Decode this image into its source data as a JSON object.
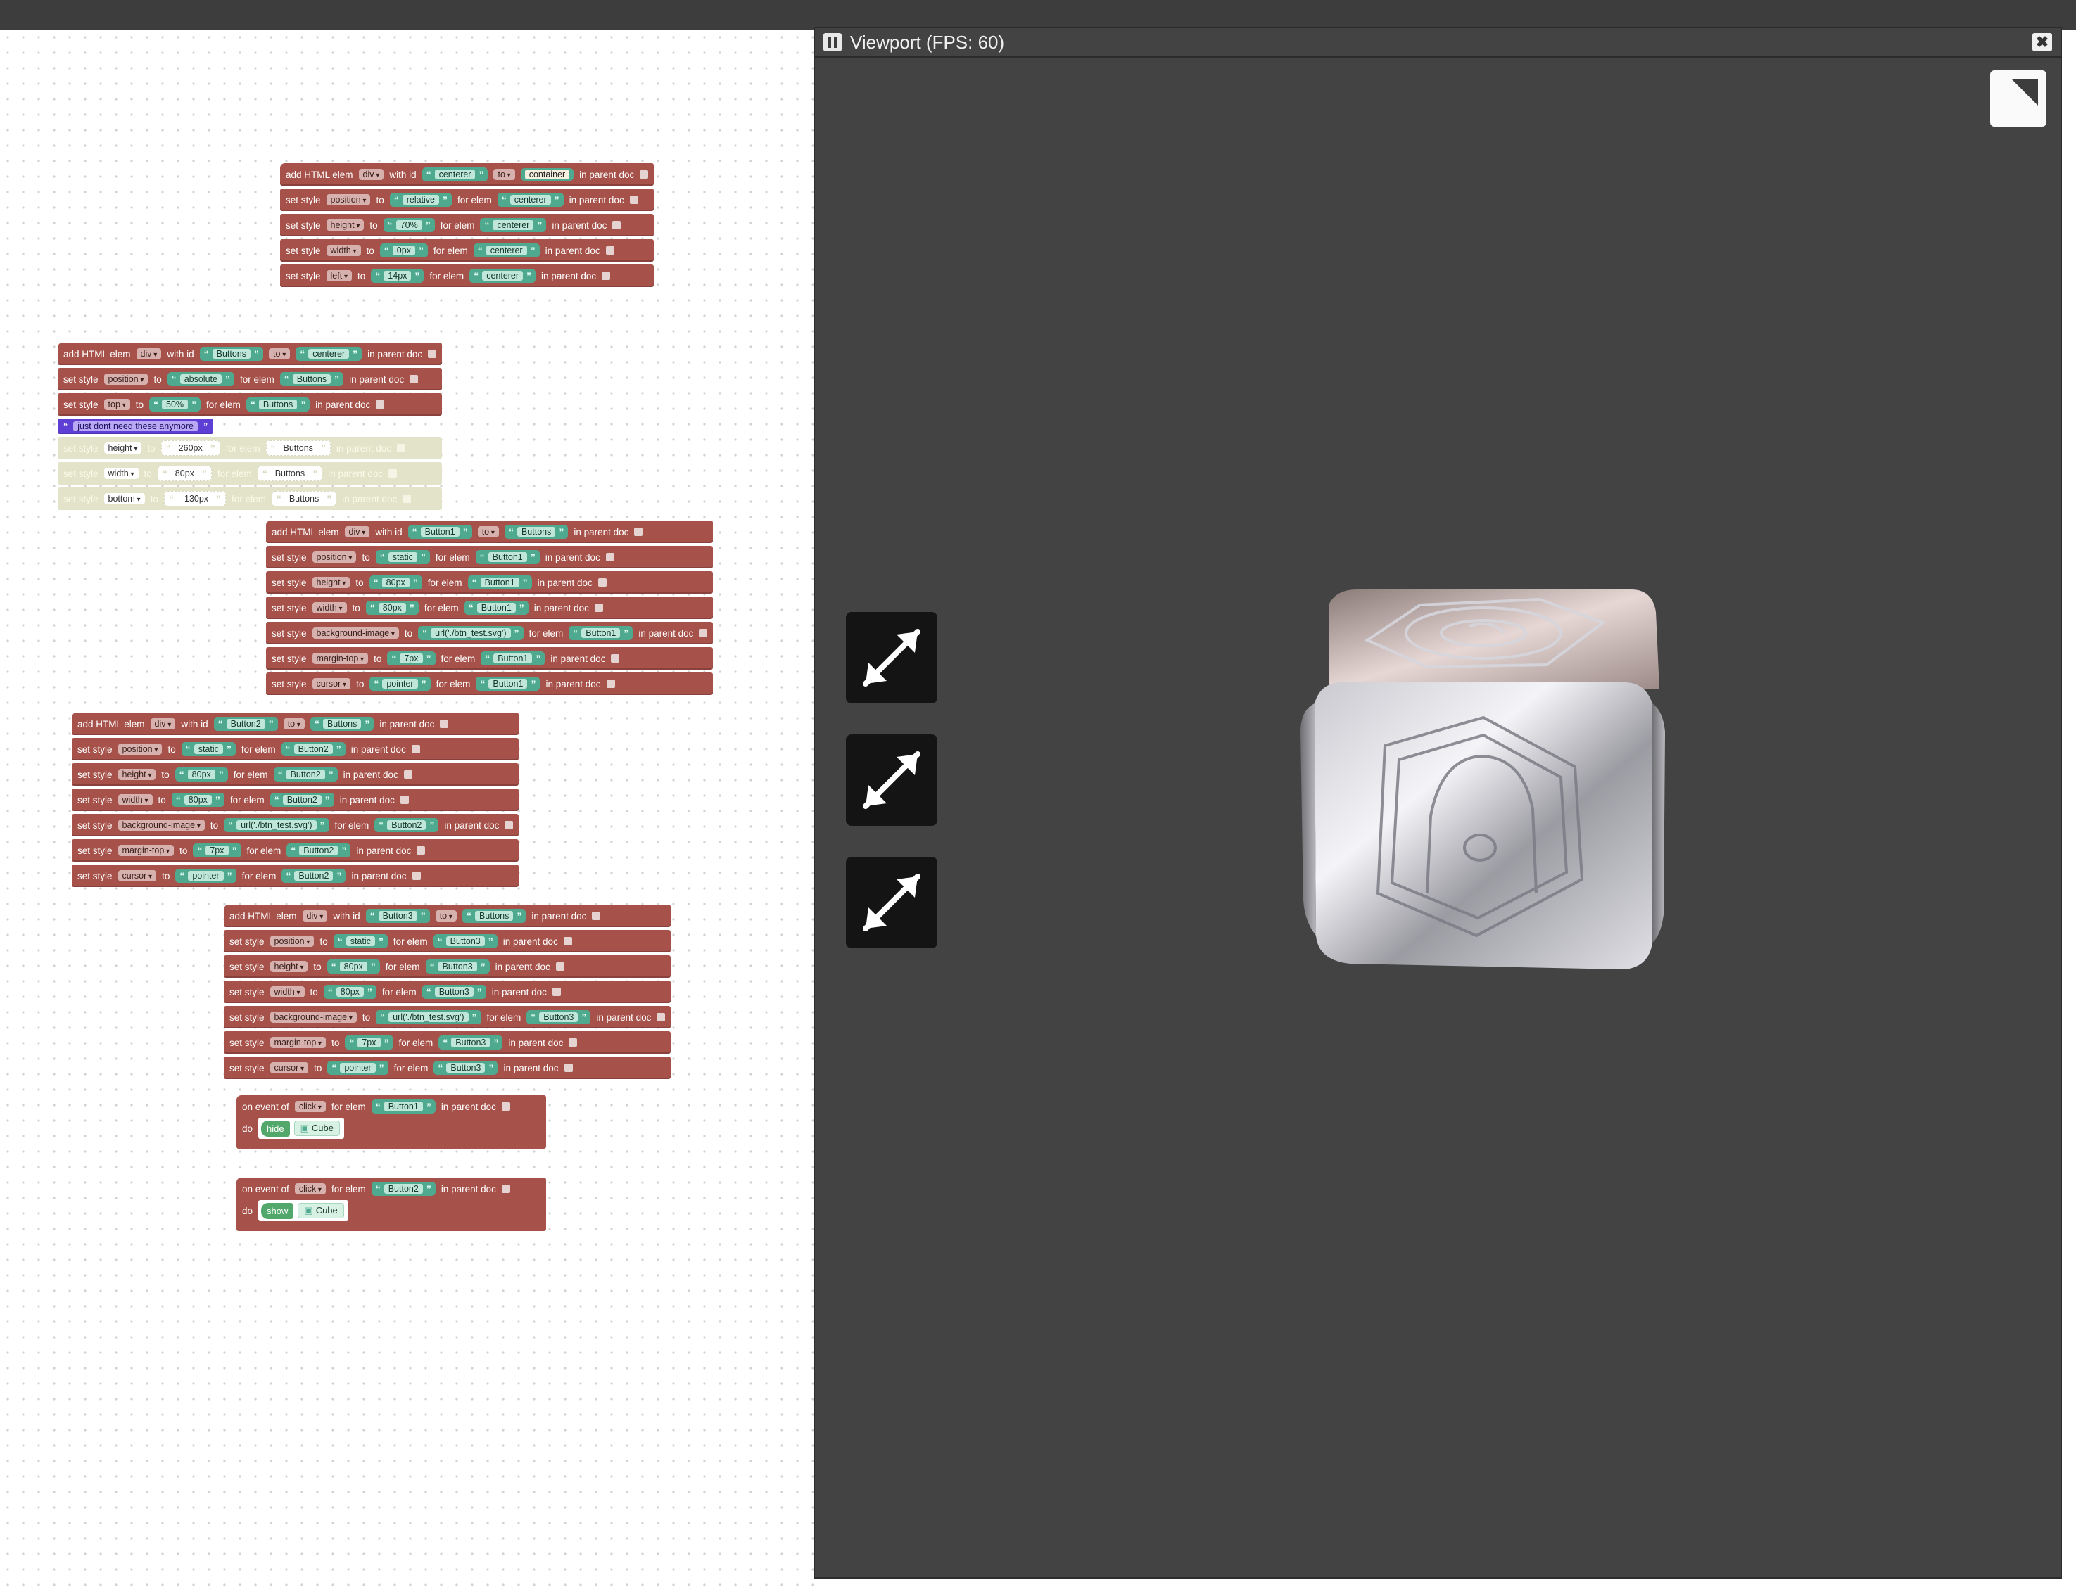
{
  "viewport": {
    "title": "Viewport (FPS: 60)",
    "close_label": "✖"
  },
  "labels": {
    "add": "add HTML elem",
    "with_id": "with id",
    "to": "to",
    "in_parent": "in parent doc",
    "set_style": "set style",
    "for_elem": "for elem",
    "on_event": "on event of",
    "do": "do",
    "q_open": "“",
    "q_close": "”"
  },
  "comment_text": "just dont need these anymore",
  "stack1": {
    "tag": "div",
    "id": "centerer",
    "to": "to",
    "parent": "container",
    "styles": [
      {
        "prop": "position",
        "value": "relative",
        "elem": "centerer"
      },
      {
        "prop": "height",
        "value": "70%",
        "elem": "centerer"
      },
      {
        "prop": "width",
        "value": "0px",
        "elem": "centerer"
      },
      {
        "prop": "left",
        "value": "14px",
        "elem": "centerer"
      }
    ]
  },
  "stack2": {
    "tag": "div",
    "id": "Buttons",
    "to": "to",
    "parent": "centerer",
    "styles": [
      {
        "prop": "position",
        "value": "absolute",
        "elem": "Buttons"
      },
      {
        "prop": "top",
        "value": "50%",
        "elem": "Buttons"
      }
    ],
    "disabled": [
      {
        "prop": "height",
        "value": "260px",
        "elem": "Buttons"
      },
      {
        "prop": "width",
        "value": "80px",
        "elem": "Buttons"
      },
      {
        "prop": "bottom",
        "value": "-130px",
        "elem": "Buttons"
      }
    ]
  },
  "stack3": {
    "tag": "div",
    "id": "Button1",
    "to": "to",
    "parent": "Buttons",
    "styles": [
      {
        "prop": "position",
        "value": "static",
        "elem": "Button1"
      },
      {
        "prop": "height",
        "value": "80px",
        "elem": "Button1"
      },
      {
        "prop": "width",
        "value": "80px",
        "elem": "Button1"
      },
      {
        "prop": "background-image",
        "value": "url('./btn_test.svg')",
        "elem": "Button1"
      },
      {
        "prop": "margin-top",
        "value": "7px",
        "elem": "Button1"
      },
      {
        "prop": "cursor",
        "value": "pointer",
        "elem": "Button1"
      }
    ]
  },
  "stack4": {
    "tag": "div",
    "id": "Button2",
    "to": "to",
    "parent": "Buttons",
    "styles": [
      {
        "prop": "position",
        "value": "static",
        "elem": "Button2"
      },
      {
        "prop": "height",
        "value": "80px",
        "elem": "Button2"
      },
      {
        "prop": "width",
        "value": "80px",
        "elem": "Button2"
      },
      {
        "prop": "background-image",
        "value": "url('./btn_test.svg')",
        "elem": "Button2"
      },
      {
        "prop": "margin-top",
        "value": "7px",
        "elem": "Button2"
      },
      {
        "prop": "cursor",
        "value": "pointer",
        "elem": "Button2"
      }
    ]
  },
  "stack5": {
    "tag": "div",
    "id": "Button3",
    "to": "to",
    "parent": "Buttons",
    "styles": [
      {
        "prop": "position",
        "value": "static",
        "elem": "Button3"
      },
      {
        "prop": "height",
        "value": "80px",
        "elem": "Button3"
      },
      {
        "prop": "width",
        "value": "80px",
        "elem": "Button3"
      },
      {
        "prop": "background-image",
        "value": "url('./btn_test.svg')",
        "elem": "Button3"
      },
      {
        "prop": "margin-top",
        "value": "7px",
        "elem": "Button3"
      },
      {
        "prop": "cursor",
        "value": "pointer",
        "elem": "Button3"
      }
    ]
  },
  "event1": {
    "event": "click",
    "elem": "Button1",
    "action": "hide",
    "object": "Cube"
  },
  "event2": {
    "event": "click",
    "elem": "Button2",
    "action": "show",
    "object": "Cube"
  }
}
